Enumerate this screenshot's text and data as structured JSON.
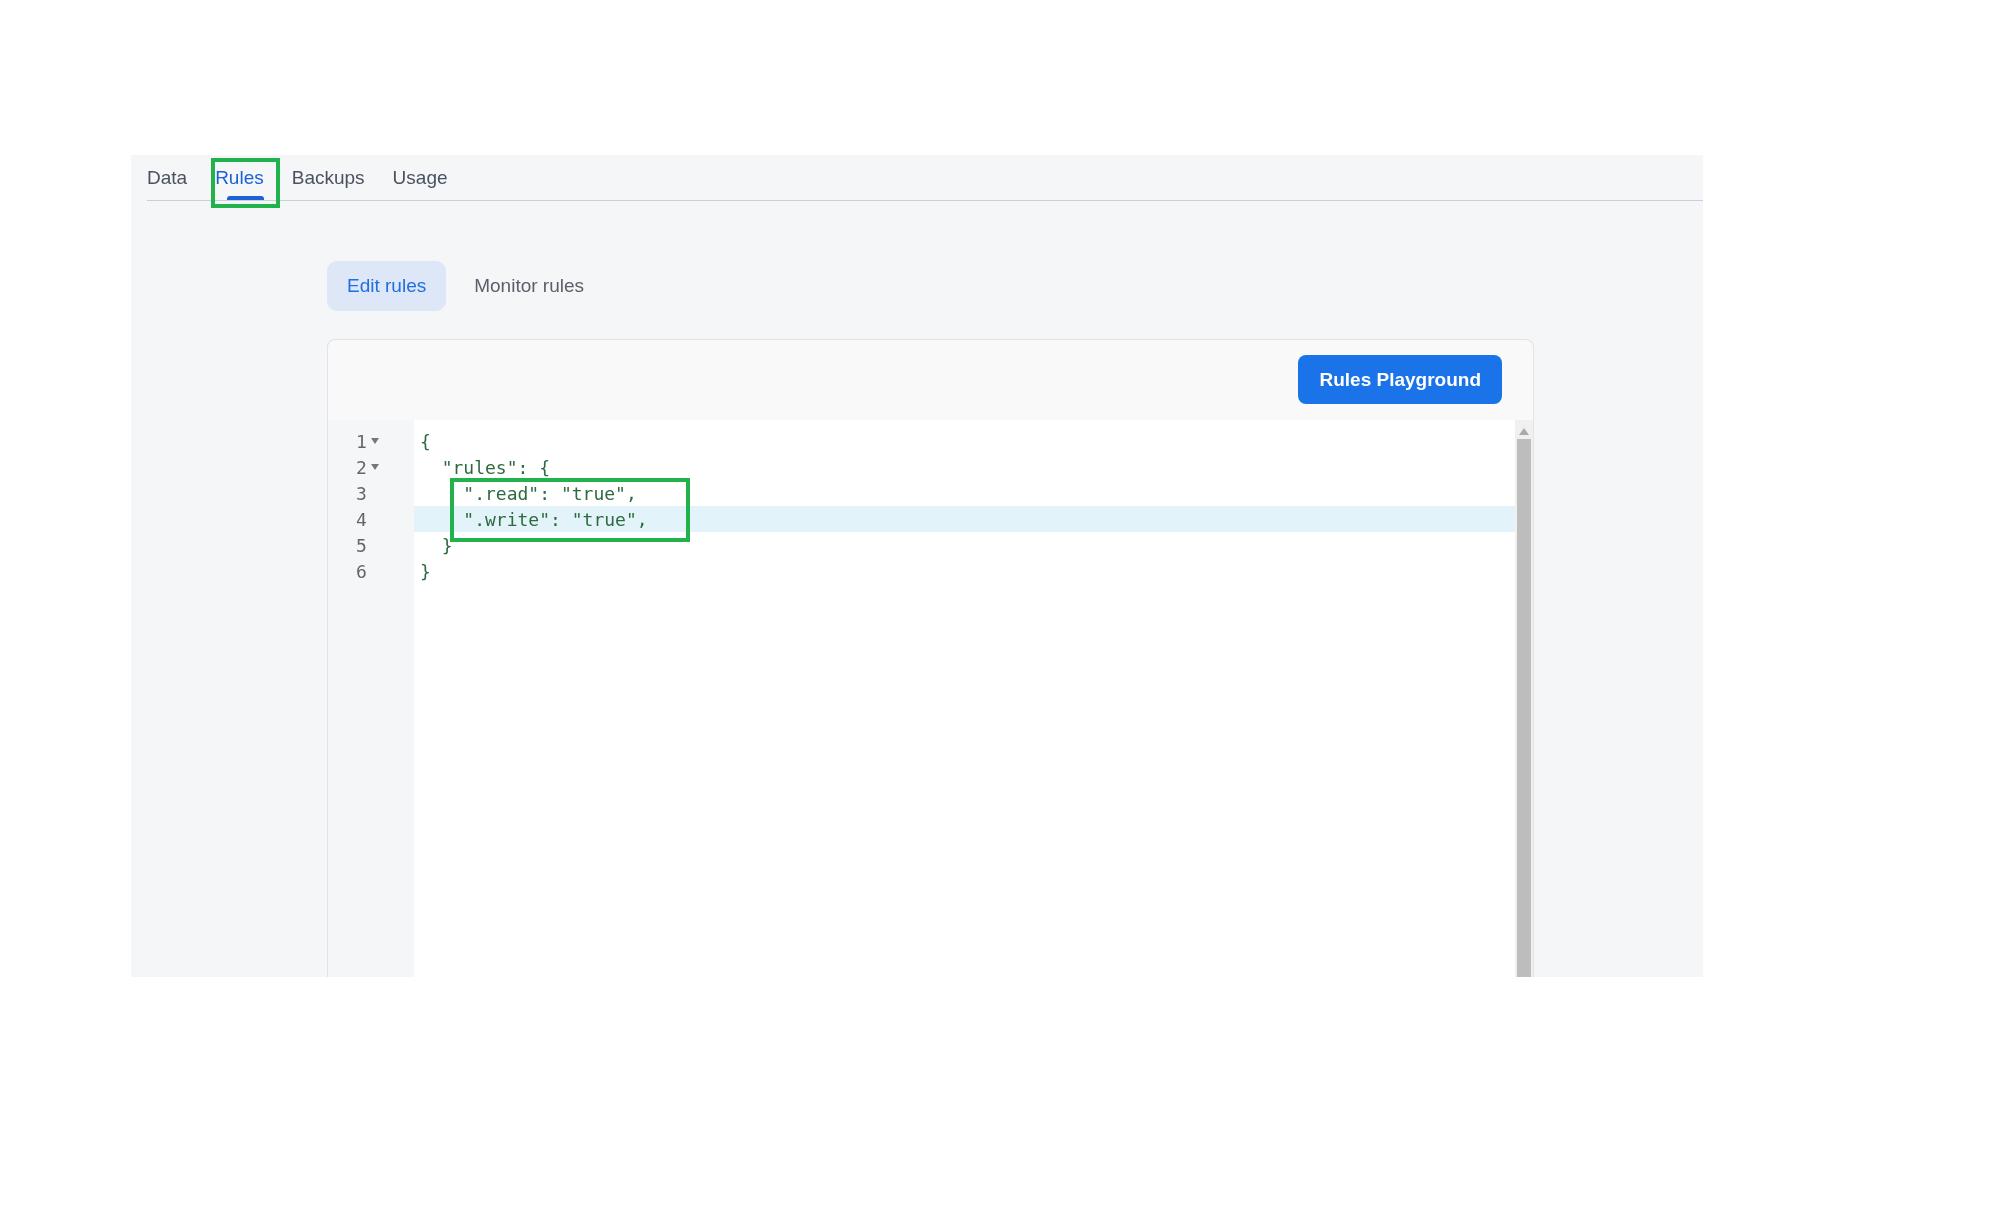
{
  "tabs": [
    {
      "label": "Data",
      "selected": false,
      "annotated": false
    },
    {
      "label": "Rules",
      "selected": true,
      "annotated": true
    },
    {
      "label": "Backups",
      "selected": false,
      "annotated": false
    },
    {
      "label": "Usage",
      "selected": false,
      "annotated": false
    }
  ],
  "subtabs": [
    {
      "label": "Edit rules",
      "selected": true
    },
    {
      "label": "Monitor rules",
      "selected": false
    }
  ],
  "editor": {
    "button": "Rules Playground",
    "lines": [
      {
        "number": "1",
        "foldable": true,
        "text": "{",
        "active": false,
        "annotated": false
      },
      {
        "number": "2",
        "foldable": true,
        "text": "  \"rules\": {",
        "active": false,
        "annotated": false
      },
      {
        "number": "3",
        "foldable": false,
        "text": "    \".read\": \"true\",",
        "active": false,
        "annotated": true
      },
      {
        "number": "4",
        "foldable": false,
        "text": "    \".write\": \"true\",",
        "active": true,
        "annotated": true
      },
      {
        "number": "5",
        "foldable": false,
        "text": "  }",
        "active": false,
        "annotated": false
      },
      {
        "number": "6",
        "foldable": false,
        "text": "}",
        "active": false,
        "annotated": false
      }
    ]
  }
}
